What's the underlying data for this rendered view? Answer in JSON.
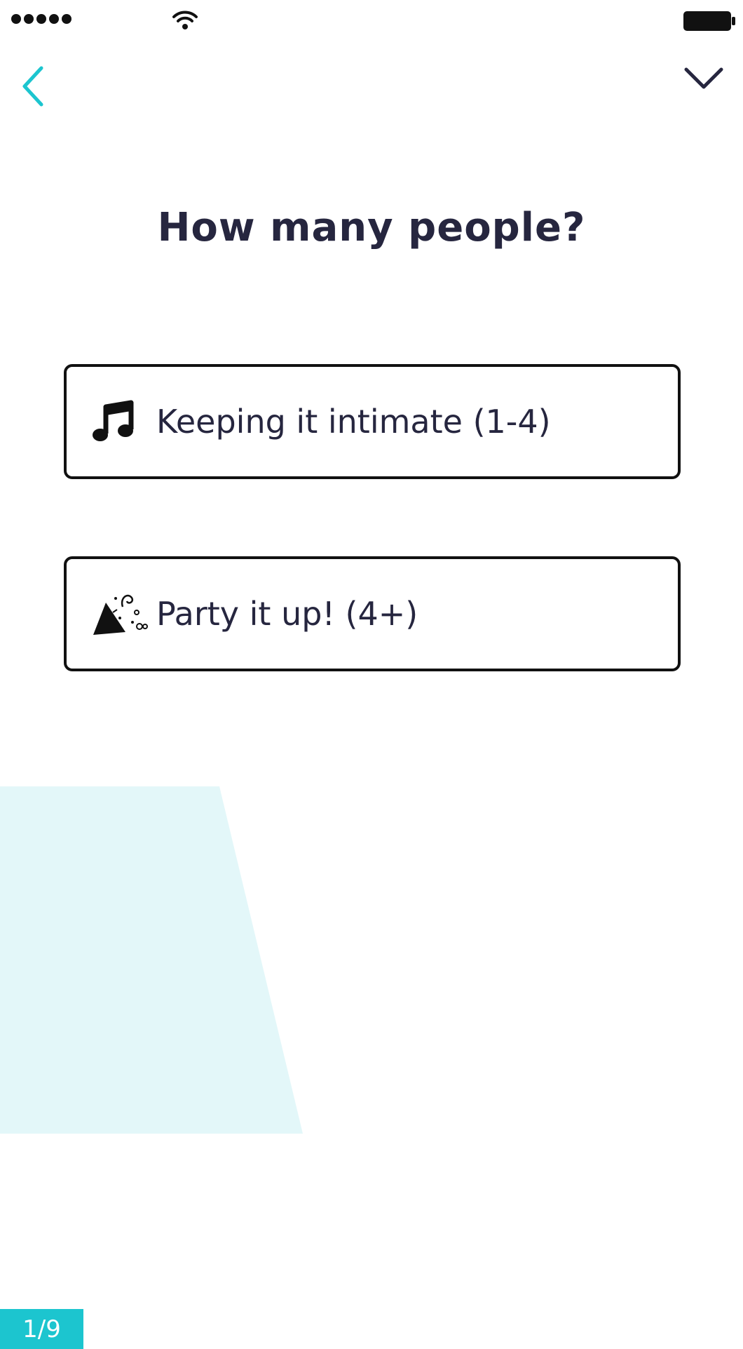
{
  "status_bar": {
    "signal_icon": "signal-dots-icon",
    "wifi_icon": "wifi-icon",
    "battery_icon": "battery-icon"
  },
  "nav": {
    "back_icon": "chevron-left-icon",
    "close_icon": "chevron-down-icon",
    "accent_color": "#1cc5cf"
  },
  "question": {
    "title": "How many people?"
  },
  "options": [
    {
      "label": "Keeping it intimate (1-4)",
      "icon": "music-note-icon"
    },
    {
      "label": "Party it up! (4+)",
      "icon": "party-popper-icon"
    }
  ],
  "progress": {
    "text": "1/9",
    "color": "#1cc5cf"
  },
  "decoration": {
    "color": "#e3f7f9"
  }
}
